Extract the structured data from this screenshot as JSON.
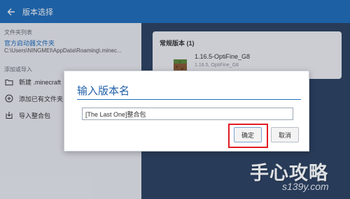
{
  "window": {
    "title": "版本选择"
  },
  "sidebar": {
    "folder_list_label": "文件夹列表",
    "official_folder": {
      "name": "官方启动器文件夹",
      "path": "C:\\Users\\NINGMEI\\AppData\\Roaming\\.minec..."
    },
    "add_import_label": "添加或导入",
    "items": [
      {
        "label": "新建 .minecraft",
        "icon": "folder-icon"
      },
      {
        "label": "添加已有文件夹",
        "icon": "plus-circle-icon"
      },
      {
        "label": "导入整合包",
        "icon": "import-icon"
      }
    ]
  },
  "versions": {
    "section_title": "常规版本 (1)",
    "items": [
      {
        "name": "1.16.5-OptiFine_G8",
        "subtitle": "1.16.5, OptiFine_G8",
        "icon": "grass-block-icon"
      }
    ]
  },
  "dialog": {
    "title": "输入版本名",
    "input_value": "[The Last One]整合包",
    "ok_label": "确定",
    "cancel_label": "取消",
    "highlight_color": "#e11b22"
  },
  "watermark": {
    "main": "手心攻略",
    "sub": "s139y.com"
  },
  "colors": {
    "accent": "#1f6fbf",
    "sidebar_bg": "#eef0f4",
    "panel_bg": "#2d4262"
  }
}
